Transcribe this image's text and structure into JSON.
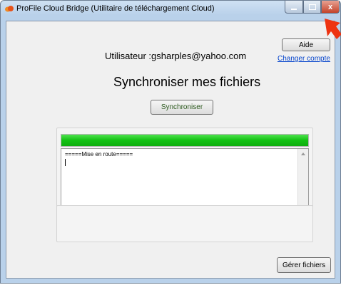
{
  "window": {
    "title": "ProFile Cloud Bridge (Utilitaire de téléchargement Cloud)",
    "controls": {
      "close": "x"
    }
  },
  "header": {
    "user_line": "Utilisateur :gsharples@yahoo.com",
    "help_label": "Aide",
    "change_account_label": "Changer compte"
  },
  "main": {
    "heading": "Synchroniser mes fichiers",
    "sync_label": "Synchroniser",
    "progress": 1.0,
    "log_text": "=====Mise en route=====",
    "manage_files_label": "Gérer fichiers"
  },
  "colors": {
    "progress": "#13c113",
    "link": "#0645cc",
    "close": "#c4432a",
    "pointer": "#ee3311"
  }
}
